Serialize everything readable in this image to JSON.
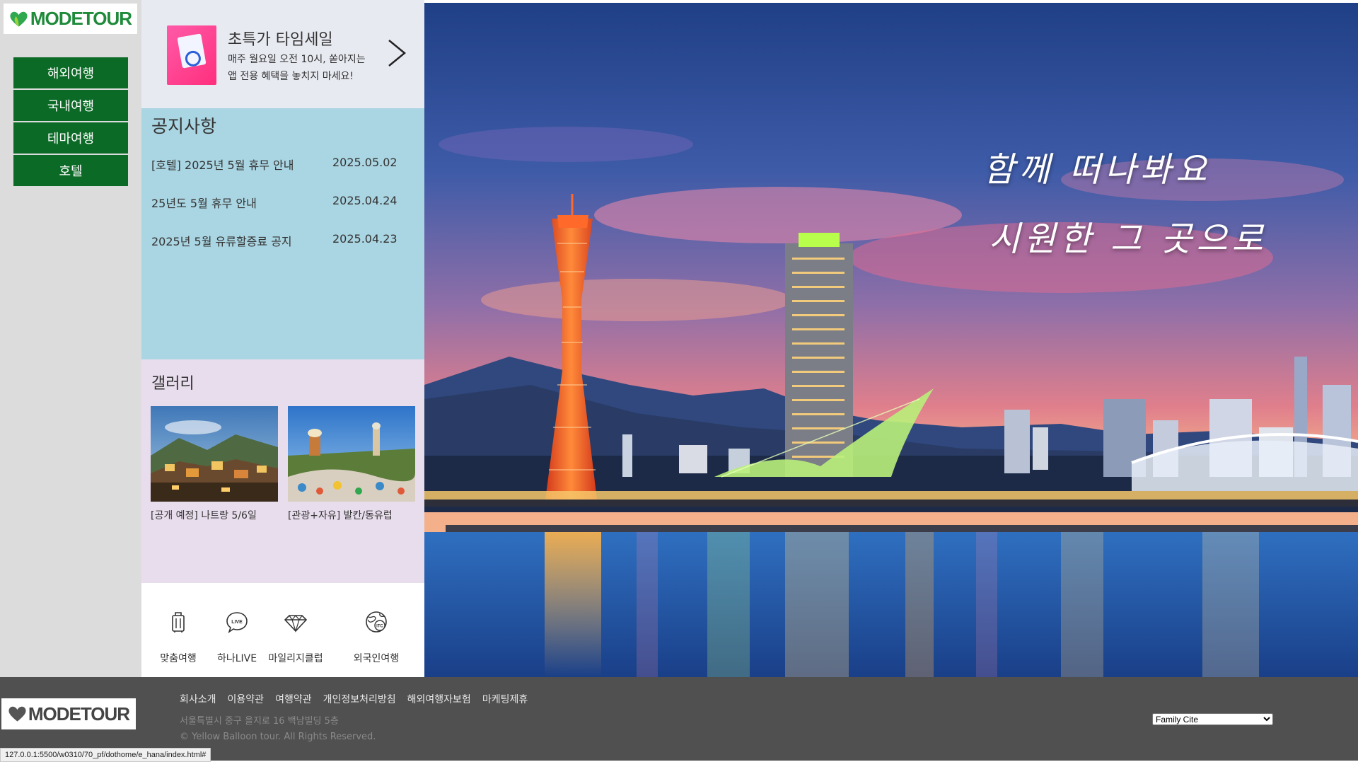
{
  "brand": {
    "logo_text": "MODETOUR",
    "color": "#1e8a3a"
  },
  "gnb": [
    {
      "label": "해외여행"
    },
    {
      "label": "국내여행"
    },
    {
      "label": "테마여행"
    },
    {
      "label": "호텔"
    }
  ],
  "promo": {
    "title": "초특가 타임세일",
    "desc_line1": "매주 월요일 오전 10시, 쏟아지는",
    "desc_line2": "앱 전용 혜택을 놓치지 마세요!",
    "arrow_icon": "chevron-right-icon"
  },
  "notice": {
    "title": "공지사항",
    "items": [
      {
        "text": "[호텔] 2025년 5월 휴무 안내",
        "date": "2025.05.02"
      },
      {
        "text": "25년도 5월 휴무 안내",
        "date": "2025.04.24"
      },
      {
        "text": "2025년 5월 유류할증료 공지",
        "date": "2025.04.23"
      }
    ]
  },
  "gallery": {
    "title": "갤러리",
    "items": [
      {
        "caption": "[공개 예정] 나트랑 5/6일"
      },
      {
        "caption": "[관광+자유] 발칸/동유럽"
      }
    ]
  },
  "quick": [
    {
      "label": "맞춤여행",
      "icon": "luggage-icon"
    },
    {
      "label": "하나LIVE",
      "icon": "live-chat-icon"
    },
    {
      "label": "마일리지클럽",
      "icon": "diamond-icon"
    },
    {
      "label": "외국인여행",
      "icon": "globe-itc-icon"
    }
  ],
  "hero": {
    "line1": "함께 떠나봐요",
    "line2": "시원한 그 곳으로"
  },
  "footer": {
    "logo_text": "MODETOUR",
    "links": [
      "회사소개",
      "이용약관",
      "여행약관",
      "개인정보처리방침",
      "해외여행자보험",
      "마케팅제휴"
    ],
    "address": "서울특별시 중구 을지로 16 백남빌딩 5층",
    "copyright": "© Yellow Balloon tour. All Rights Reserved.",
    "family_site": "Family Cite"
  },
  "status_url": "127.0.0.1:5500/w0310/70_pf/dothome/e_hana/index.html#"
}
